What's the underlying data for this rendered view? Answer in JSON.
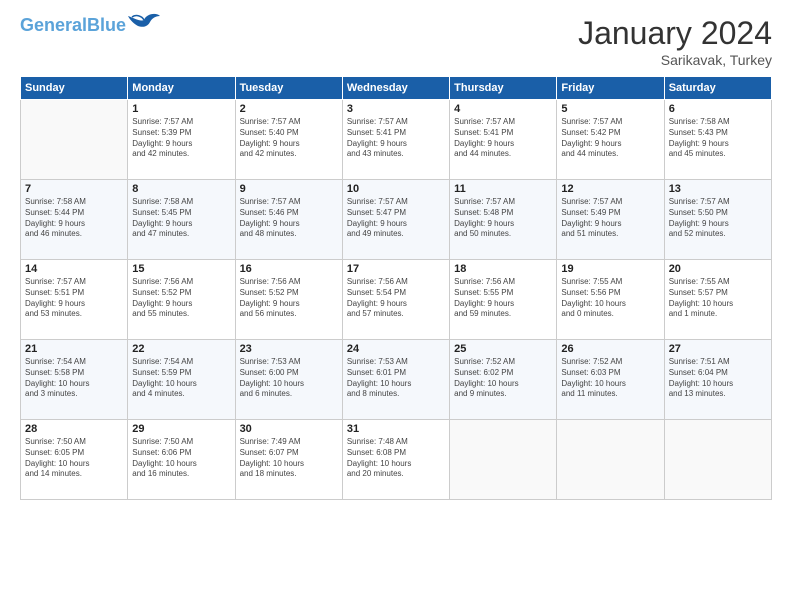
{
  "logo": {
    "line1": "General",
    "line2": "Blue"
  },
  "header": {
    "month": "January 2024",
    "location": "Sarikavak, Turkey"
  },
  "weekdays": [
    "Sunday",
    "Monday",
    "Tuesday",
    "Wednesday",
    "Thursday",
    "Friday",
    "Saturday"
  ],
  "weeks": [
    [
      {
        "day": "",
        "info": ""
      },
      {
        "day": "1",
        "info": "Sunrise: 7:57 AM\nSunset: 5:39 PM\nDaylight: 9 hours\nand 42 minutes."
      },
      {
        "day": "2",
        "info": "Sunrise: 7:57 AM\nSunset: 5:40 PM\nDaylight: 9 hours\nand 42 minutes."
      },
      {
        "day": "3",
        "info": "Sunrise: 7:57 AM\nSunset: 5:41 PM\nDaylight: 9 hours\nand 43 minutes."
      },
      {
        "day": "4",
        "info": "Sunrise: 7:57 AM\nSunset: 5:41 PM\nDaylight: 9 hours\nand 44 minutes."
      },
      {
        "day": "5",
        "info": "Sunrise: 7:57 AM\nSunset: 5:42 PM\nDaylight: 9 hours\nand 44 minutes."
      },
      {
        "day": "6",
        "info": "Sunrise: 7:58 AM\nSunset: 5:43 PM\nDaylight: 9 hours\nand 45 minutes."
      }
    ],
    [
      {
        "day": "7",
        "info": "Sunrise: 7:58 AM\nSunset: 5:44 PM\nDaylight: 9 hours\nand 46 minutes."
      },
      {
        "day": "8",
        "info": "Sunrise: 7:58 AM\nSunset: 5:45 PM\nDaylight: 9 hours\nand 47 minutes."
      },
      {
        "day": "9",
        "info": "Sunrise: 7:57 AM\nSunset: 5:46 PM\nDaylight: 9 hours\nand 48 minutes."
      },
      {
        "day": "10",
        "info": "Sunrise: 7:57 AM\nSunset: 5:47 PM\nDaylight: 9 hours\nand 49 minutes."
      },
      {
        "day": "11",
        "info": "Sunrise: 7:57 AM\nSunset: 5:48 PM\nDaylight: 9 hours\nand 50 minutes."
      },
      {
        "day": "12",
        "info": "Sunrise: 7:57 AM\nSunset: 5:49 PM\nDaylight: 9 hours\nand 51 minutes."
      },
      {
        "day": "13",
        "info": "Sunrise: 7:57 AM\nSunset: 5:50 PM\nDaylight: 9 hours\nand 52 minutes."
      }
    ],
    [
      {
        "day": "14",
        "info": "Sunrise: 7:57 AM\nSunset: 5:51 PM\nDaylight: 9 hours\nand 53 minutes."
      },
      {
        "day": "15",
        "info": "Sunrise: 7:56 AM\nSunset: 5:52 PM\nDaylight: 9 hours\nand 55 minutes."
      },
      {
        "day": "16",
        "info": "Sunrise: 7:56 AM\nSunset: 5:52 PM\nDaylight: 9 hours\nand 56 minutes."
      },
      {
        "day": "17",
        "info": "Sunrise: 7:56 AM\nSunset: 5:54 PM\nDaylight: 9 hours\nand 57 minutes."
      },
      {
        "day": "18",
        "info": "Sunrise: 7:56 AM\nSunset: 5:55 PM\nDaylight: 9 hours\nand 59 minutes."
      },
      {
        "day": "19",
        "info": "Sunrise: 7:55 AM\nSunset: 5:56 PM\nDaylight: 10 hours\nand 0 minutes."
      },
      {
        "day": "20",
        "info": "Sunrise: 7:55 AM\nSunset: 5:57 PM\nDaylight: 10 hours\nand 1 minute."
      }
    ],
    [
      {
        "day": "21",
        "info": "Sunrise: 7:54 AM\nSunset: 5:58 PM\nDaylight: 10 hours\nand 3 minutes."
      },
      {
        "day": "22",
        "info": "Sunrise: 7:54 AM\nSunset: 5:59 PM\nDaylight: 10 hours\nand 4 minutes."
      },
      {
        "day": "23",
        "info": "Sunrise: 7:53 AM\nSunset: 6:00 PM\nDaylight: 10 hours\nand 6 minutes."
      },
      {
        "day": "24",
        "info": "Sunrise: 7:53 AM\nSunset: 6:01 PM\nDaylight: 10 hours\nand 8 minutes."
      },
      {
        "day": "25",
        "info": "Sunrise: 7:52 AM\nSunset: 6:02 PM\nDaylight: 10 hours\nand 9 minutes."
      },
      {
        "day": "26",
        "info": "Sunrise: 7:52 AM\nSunset: 6:03 PM\nDaylight: 10 hours\nand 11 minutes."
      },
      {
        "day": "27",
        "info": "Sunrise: 7:51 AM\nSunset: 6:04 PM\nDaylight: 10 hours\nand 13 minutes."
      }
    ],
    [
      {
        "day": "28",
        "info": "Sunrise: 7:50 AM\nSunset: 6:05 PM\nDaylight: 10 hours\nand 14 minutes."
      },
      {
        "day": "29",
        "info": "Sunrise: 7:50 AM\nSunset: 6:06 PM\nDaylight: 10 hours\nand 16 minutes."
      },
      {
        "day": "30",
        "info": "Sunrise: 7:49 AM\nSunset: 6:07 PM\nDaylight: 10 hours\nand 18 minutes."
      },
      {
        "day": "31",
        "info": "Sunrise: 7:48 AM\nSunset: 6:08 PM\nDaylight: 10 hours\nand 20 minutes."
      },
      {
        "day": "",
        "info": ""
      },
      {
        "day": "",
        "info": ""
      },
      {
        "day": "",
        "info": ""
      }
    ]
  ]
}
